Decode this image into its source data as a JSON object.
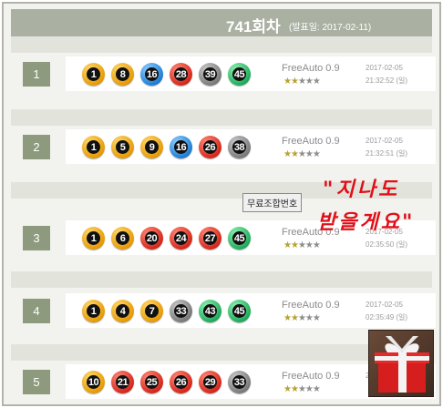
{
  "header": {
    "round": "741회차",
    "announce": "(발표일: 2017-02-11)"
  },
  "rows": [
    {
      "rank": "1",
      "balls": [
        {
          "n": "1",
          "color": "yellow"
        },
        {
          "n": "8",
          "color": "yellow"
        },
        {
          "n": "16",
          "color": "blue"
        },
        {
          "n": "28",
          "color": "red"
        },
        {
          "n": "39",
          "color": "gray"
        },
        {
          "n": "45",
          "color": "green"
        }
      ],
      "method": "FreeAuto 0.9",
      "rating": 2,
      "date": "2017-02-05",
      "time": "21:32:52 (일)"
    },
    {
      "rank": "2",
      "balls": [
        {
          "n": "1",
          "color": "yellow"
        },
        {
          "n": "5",
          "color": "yellow"
        },
        {
          "n": "9",
          "color": "yellow"
        },
        {
          "n": "16",
          "color": "blue"
        },
        {
          "n": "26",
          "color": "red"
        },
        {
          "n": "38",
          "color": "gray"
        }
      ],
      "method": "FreeAuto 0.9",
      "rating": 2,
      "date": "2017-02-05",
      "time": "21:32:51 (일)"
    },
    {
      "rank": "3",
      "balls": [
        {
          "n": "1",
          "color": "yellow"
        },
        {
          "n": "6",
          "color": "yellow"
        },
        {
          "n": "20",
          "color": "red"
        },
        {
          "n": "24",
          "color": "red"
        },
        {
          "n": "27",
          "color": "red"
        },
        {
          "n": "45",
          "color": "green"
        }
      ],
      "method": "FreeAuto 0.9",
      "rating": 2,
      "date": "2017-02-05",
      "time": "02:35:50 (일)"
    },
    {
      "rank": "4",
      "balls": [
        {
          "n": "1",
          "color": "yellow"
        },
        {
          "n": "4",
          "color": "yellow"
        },
        {
          "n": "7",
          "color": "yellow"
        },
        {
          "n": "33",
          "color": "gray"
        },
        {
          "n": "43",
          "color": "green"
        },
        {
          "n": "45",
          "color": "green"
        }
      ],
      "method": "FreeAuto 0.9",
      "rating": 2,
      "date": "2017-02-05",
      "time": "02:35:49 (일)"
    },
    {
      "rank": "5",
      "balls": [
        {
          "n": "10",
          "color": "yellow"
        },
        {
          "n": "21",
          "color": "red"
        },
        {
          "n": "25",
          "color": "red"
        },
        {
          "n": "26",
          "color": "red"
        },
        {
          "n": "29",
          "color": "red"
        },
        {
          "n": "33",
          "color": "gray"
        }
      ],
      "method": "FreeAuto 0.9",
      "rating": 2,
      "date": "2017-02-05",
      "time": ""
    }
  ],
  "rating_max": 5,
  "free_label": "무료조합번호",
  "overlay": {
    "line1": "\"지나도",
    "line2": "받을게요\""
  },
  "gift_icon": "gift-box-icon",
  "colors": {
    "header": "#aab1a3",
    "badge": "#8d9a7d",
    "band": "#e2e4dc",
    "overlay": "#e0101a"
  }
}
